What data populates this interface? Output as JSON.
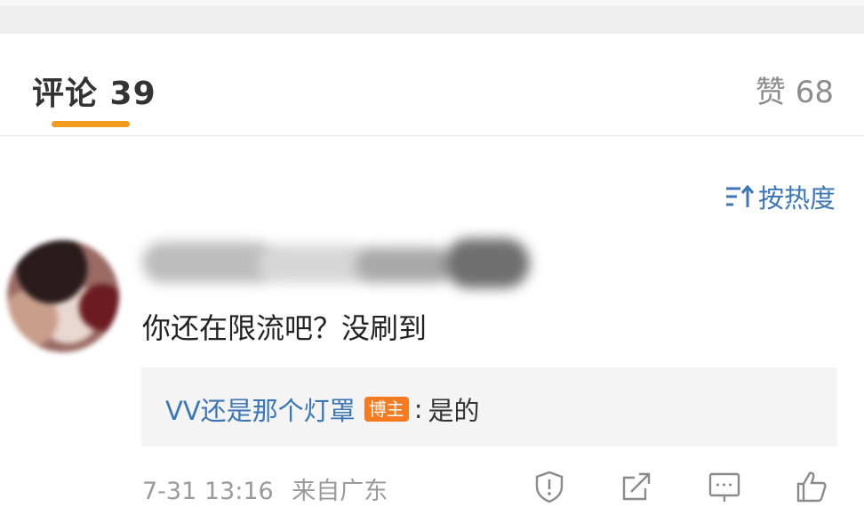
{
  "tabs": {
    "comments_label": "评论 39",
    "likes_label": "赞 68",
    "accent_color": "#f39b1f"
  },
  "sort": {
    "label": "按热度",
    "icon": "sort-icon"
  },
  "comment": {
    "username_state": "blurred",
    "text": "你还在限流吧？没刷到",
    "reply": {
      "author": "VV还是那个灯罩",
      "badge": "博主",
      "colon": ":",
      "text": "是的"
    },
    "time": "7-31 13:16",
    "source": "来自广东",
    "actions": [
      "report-icon",
      "share-icon",
      "reply-icon",
      "like-icon"
    ]
  },
  "colors": {
    "link_blue": "#3b76b6",
    "badge_orange": "#f57a20",
    "reply_bg": "#f4f4f4"
  }
}
